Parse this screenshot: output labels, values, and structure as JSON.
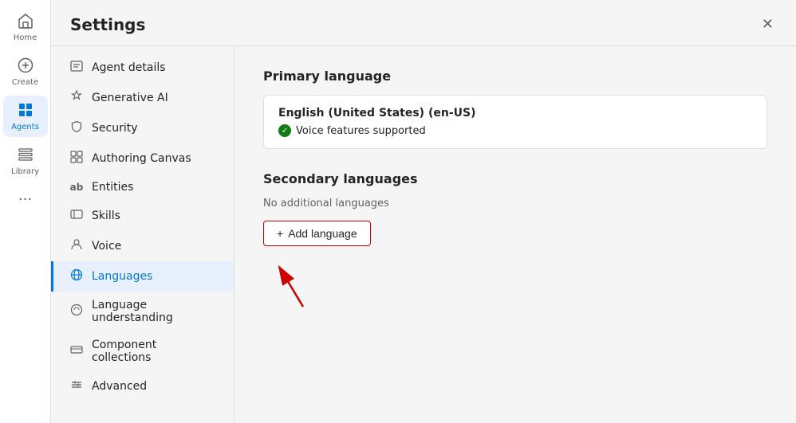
{
  "nav": {
    "items": [
      {
        "id": "home",
        "label": "Home",
        "icon": "⌂",
        "active": false
      },
      {
        "id": "create",
        "label": "Create",
        "icon": "+",
        "active": false
      },
      {
        "id": "agents",
        "label": "Agents",
        "icon": "◈",
        "active": true
      },
      {
        "id": "library",
        "label": "Library",
        "icon": "⊞",
        "active": false
      }
    ],
    "more_icon": "···"
  },
  "settings": {
    "title": "Settings",
    "close_label": "✕",
    "sidebar_items": [
      {
        "id": "agent-details",
        "label": "Agent details",
        "icon": "☰",
        "active": false
      },
      {
        "id": "generative-ai",
        "label": "Generative AI",
        "icon": "✦",
        "active": false
      },
      {
        "id": "security",
        "label": "Security",
        "icon": "🔒",
        "active": false
      },
      {
        "id": "authoring-canvas",
        "label": "Authoring Canvas",
        "icon": "⊞",
        "active": false
      },
      {
        "id": "entities",
        "label": "Entities",
        "icon": "ab",
        "active": false
      },
      {
        "id": "skills",
        "label": "Skills",
        "icon": "⊟",
        "active": false
      },
      {
        "id": "voice",
        "label": "Voice",
        "icon": "👤",
        "active": false
      },
      {
        "id": "languages",
        "label": "Languages",
        "icon": "⚙",
        "active": true
      },
      {
        "id": "language-understanding",
        "label": "Language understanding",
        "icon": "⊙",
        "active": false
      },
      {
        "id": "component-collections",
        "label": "Component collections",
        "icon": "⊟",
        "active": false
      },
      {
        "id": "advanced",
        "label": "Advanced",
        "icon": "≈",
        "active": false
      }
    ]
  },
  "content": {
    "primary_language_title": "Primary language",
    "language_name": "English (United States) (en-US)",
    "voice_supported_text": "Voice features supported",
    "secondary_languages_title": "Secondary languages",
    "no_additional_text": "No additional languages",
    "add_language_label": "Add language",
    "add_icon": "+"
  }
}
